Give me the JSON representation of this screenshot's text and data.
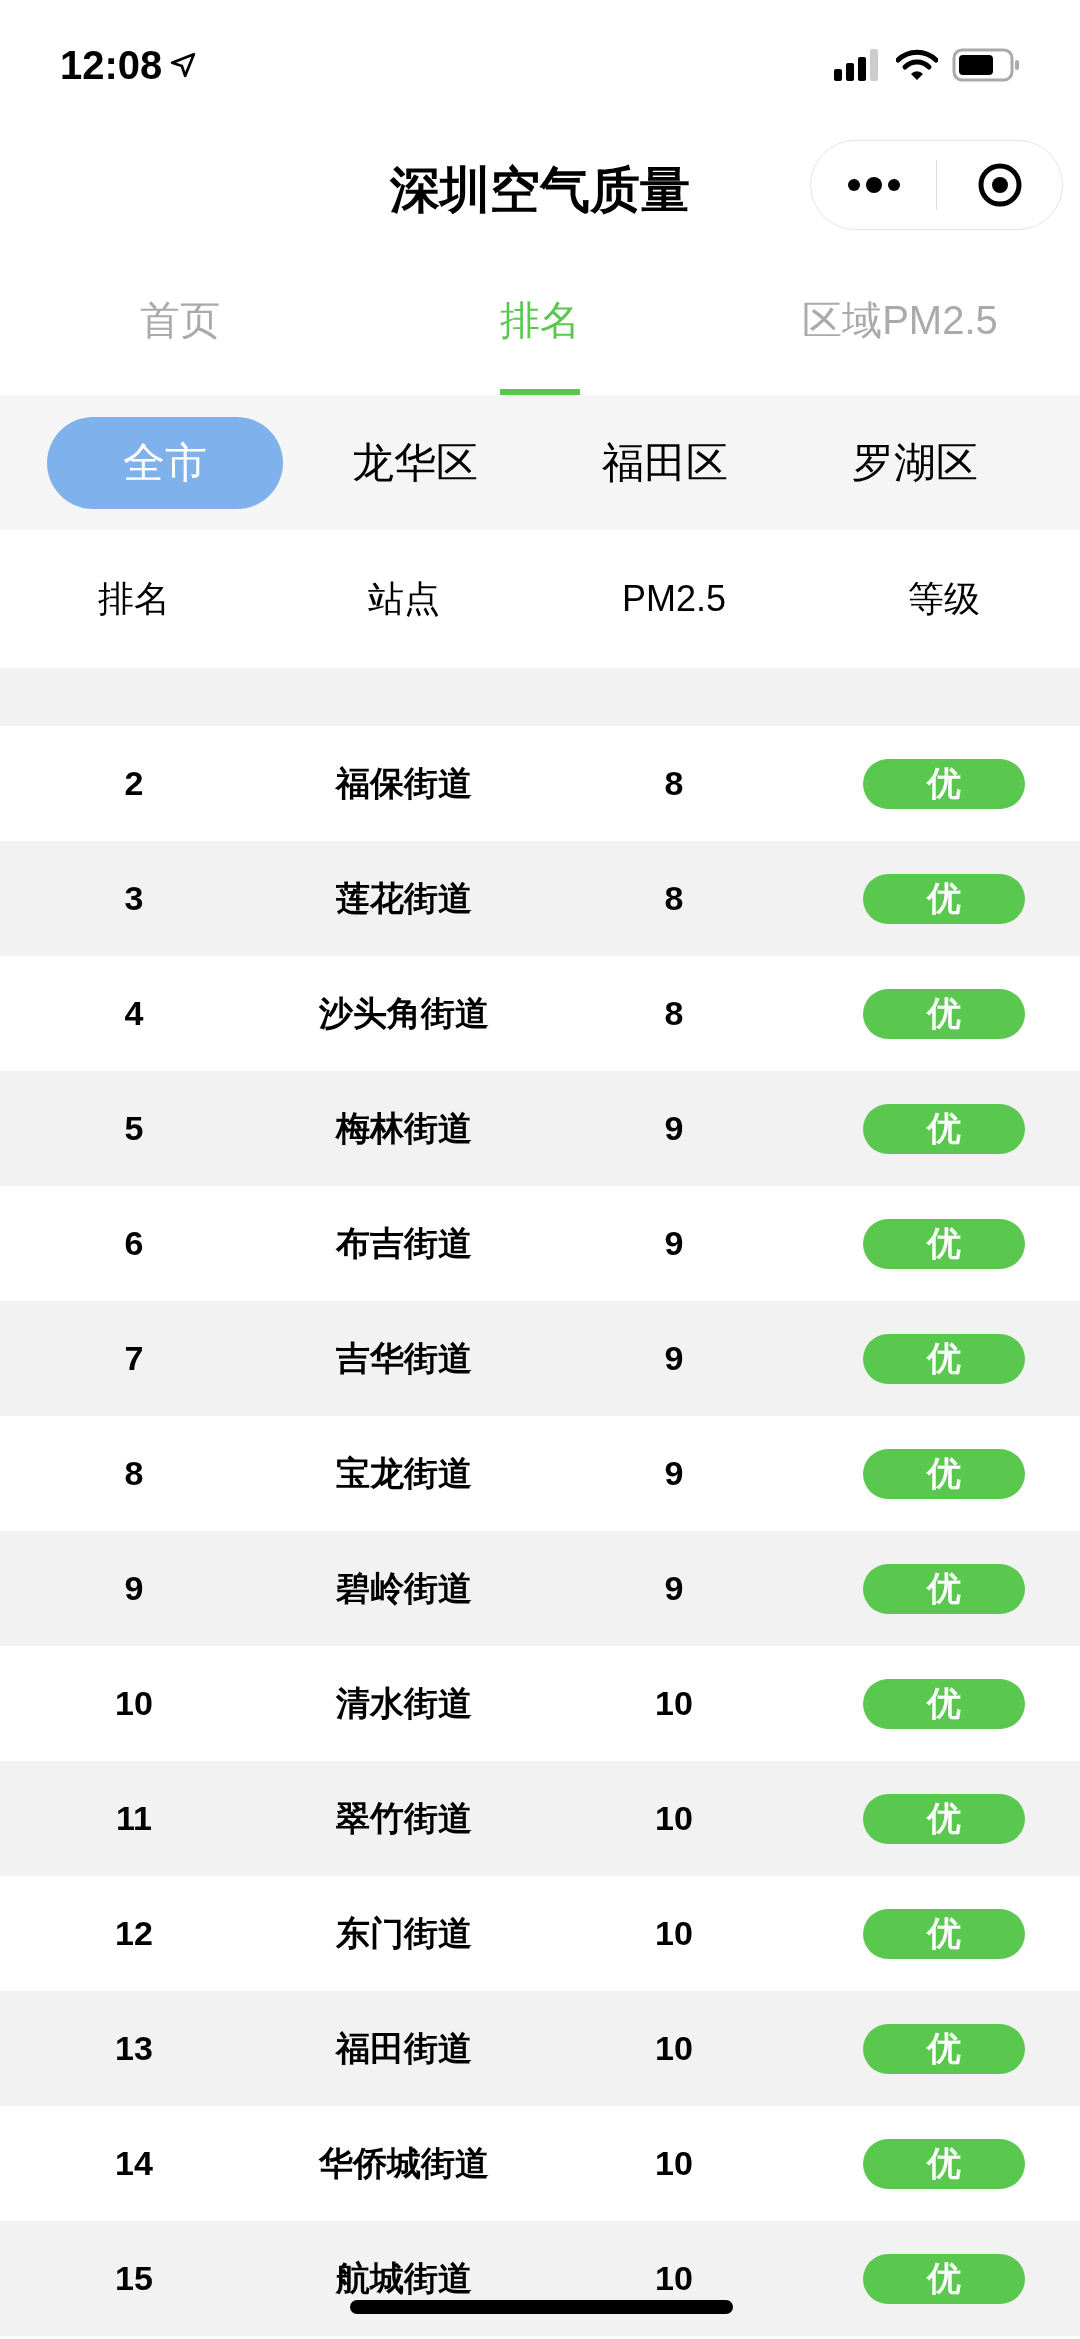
{
  "status_bar": {
    "time": "12:08"
  },
  "title": "深圳空气质量",
  "tabs": [
    {
      "label": "首页",
      "selected": false
    },
    {
      "label": "排名",
      "selected": true
    },
    {
      "label": "区域PM2.5",
      "selected": false
    }
  ],
  "districts": [
    {
      "label": "全市",
      "selected": true
    },
    {
      "label": "龙华区",
      "selected": false
    },
    {
      "label": "福田区",
      "selected": false
    },
    {
      "label": "罗湖区",
      "selected": false
    }
  ],
  "table": {
    "columns": [
      "排名",
      "站点",
      "PM2.5",
      "等级"
    ],
    "rows": [
      {
        "rank": "2",
        "station": "福保街道",
        "pm25": "8",
        "grade": "优",
        "color": "#5ac84f"
      },
      {
        "rank": "3",
        "station": "莲花街道",
        "pm25": "8",
        "grade": "优",
        "color": "#5ac84f"
      },
      {
        "rank": "4",
        "station": "沙头角街道",
        "pm25": "8",
        "grade": "优",
        "color": "#5ac84f"
      },
      {
        "rank": "5",
        "station": "梅林街道",
        "pm25": "9",
        "grade": "优",
        "color": "#5ac84f"
      },
      {
        "rank": "6",
        "station": "布吉街道",
        "pm25": "9",
        "grade": "优",
        "color": "#5ac84f"
      },
      {
        "rank": "7",
        "station": "吉华街道",
        "pm25": "9",
        "grade": "优",
        "color": "#5ac84f"
      },
      {
        "rank": "8",
        "station": "宝龙街道",
        "pm25": "9",
        "grade": "优",
        "color": "#5ac84f"
      },
      {
        "rank": "9",
        "station": "碧岭街道",
        "pm25": "9",
        "grade": "优",
        "color": "#5ac84f"
      },
      {
        "rank": "10",
        "station": "清水街道",
        "pm25": "10",
        "grade": "优",
        "color": "#5ac84f"
      },
      {
        "rank": "11",
        "station": "翠竹街道",
        "pm25": "10",
        "grade": "优",
        "color": "#5ac84f"
      },
      {
        "rank": "12",
        "station": "东门街道",
        "pm25": "10",
        "grade": "优",
        "color": "#5ac84f"
      },
      {
        "rank": "13",
        "station": "福田街道",
        "pm25": "10",
        "grade": "优",
        "color": "#5ac84f"
      },
      {
        "rank": "14",
        "station": "华侨城街道",
        "pm25": "10",
        "grade": "优",
        "color": "#5ac84f"
      },
      {
        "rank": "15",
        "station": "航城街道",
        "pm25": "10",
        "grade": "优",
        "color": "#5ac84f"
      }
    ]
  }
}
